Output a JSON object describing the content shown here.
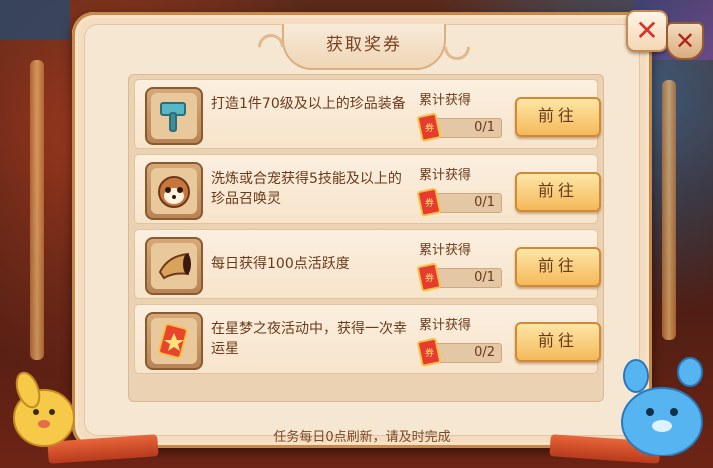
{
  "dialog": {
    "title": "获取奖券",
    "close_icon": "close-icon",
    "footer_note": "任务每日0点刷新，请及时完成"
  },
  "tasks": [
    {
      "icon": "hammer-icon",
      "description": "打造1件70级及以上的珍品装备",
      "progress_label": "累计获得",
      "progress": "0/1",
      "button": "前往"
    },
    {
      "icon": "raccoon-icon",
      "description": "洗炼或合宠获得5技能及以上的珍品召唤灵",
      "progress_label": "累计获得",
      "progress": "0/1",
      "button": "前往"
    },
    {
      "icon": "horn-icon",
      "description": "每日获得100点活跃度",
      "progress_label": "累计获得",
      "progress": "0/1",
      "button": "前往"
    },
    {
      "icon": "lucky-star-card-icon",
      "description": "在星梦之夜活动中，获得一次幸运星",
      "progress_label": "累计获得",
      "progress": "0/2",
      "button": "前往"
    }
  ],
  "colors": {
    "accent": "#f4b95a",
    "panel": "#f6e7d2",
    "text": "#6a3a1c",
    "close_red": "#d8352a"
  }
}
